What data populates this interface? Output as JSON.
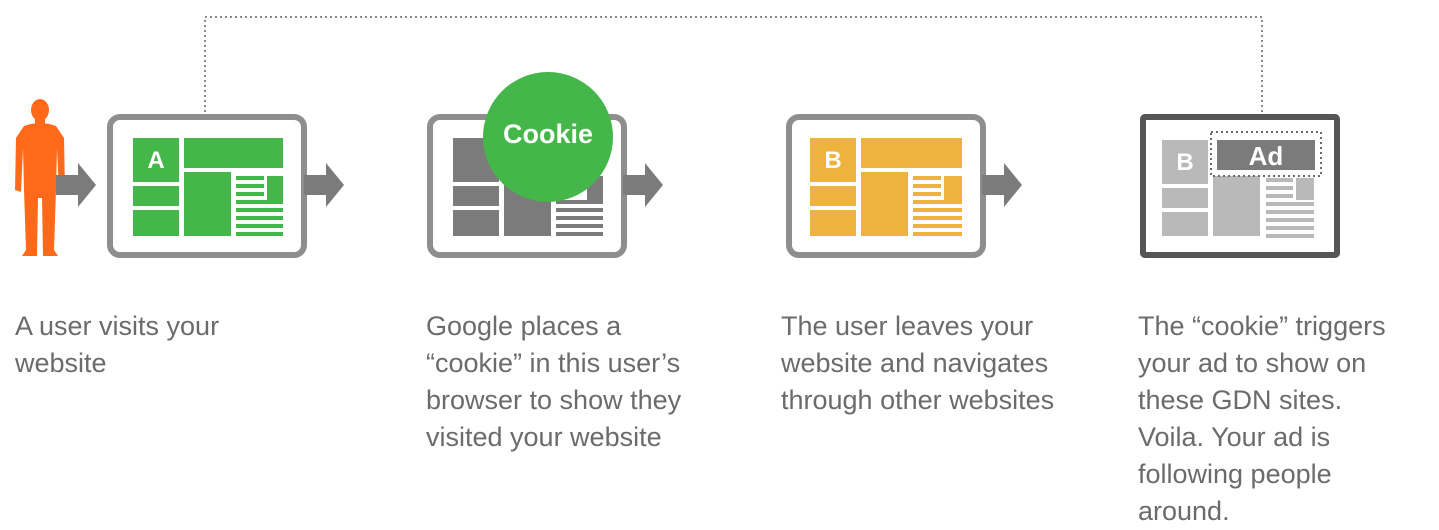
{
  "colors": {
    "green": "#45b649",
    "orange": "#ff6a1a",
    "yellow": "#eeb23e",
    "dark_gray": "#7b7b7b",
    "frame_gray": "#8e8e8e",
    "light_gray": "#b9b9b9",
    "text_gray": "#6b6b6b"
  },
  "steps": [
    {
      "screen_letter": "A",
      "caption": "A user visits your\nwebsite",
      "icon": "user-silhouette-icon"
    },
    {
      "badge_label": "Cookie",
      "caption": "Google places a\n“cookie” in this user’s\nbrowser to show they\nvisited your website"
    },
    {
      "screen_letter": "B",
      "caption": "The user leaves your\nwebsite and navigates\nthrough other websites"
    },
    {
      "screen_letter": "B",
      "ad_label": "Ad",
      "caption": "The “cookie” triggers\nyour ad to show on\nthese GDN sites.\nVoila.  Your ad is\nfollowing people\naround."
    }
  ]
}
